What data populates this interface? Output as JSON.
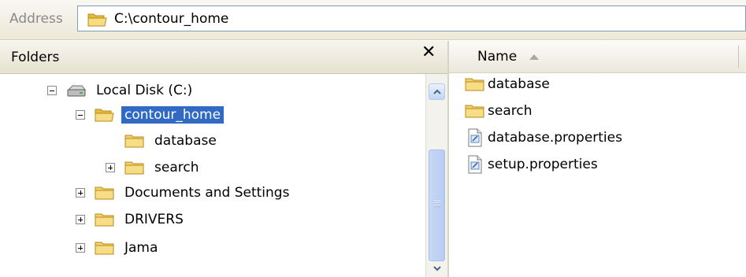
{
  "address": {
    "label": "Address",
    "path": "C:\\contour_home"
  },
  "folders_pane": {
    "title": "Folders",
    "close": "✕",
    "tree": [
      {
        "label": "Local Disk (C:)",
        "expander": "minus",
        "icon": "drive-icon"
      },
      {
        "label": "contour_home",
        "expander": "minus",
        "icon": "folder-open-icon",
        "selected": true
      },
      {
        "label": "database",
        "expander": "none",
        "icon": "folder-icon"
      },
      {
        "label": "search",
        "expander": "plus",
        "icon": "folder-icon"
      },
      {
        "label": "Documents and Settings",
        "expander": "plus",
        "icon": "folder-icon"
      },
      {
        "label": "DRIVERS",
        "expander": "plus",
        "icon": "folder-icon"
      },
      {
        "label": "Jama",
        "expander": "plus",
        "icon": "folder-icon"
      }
    ]
  },
  "file_list": {
    "column_name": "Name",
    "sort": "ascending",
    "items": [
      {
        "name": "database",
        "icon": "folder-icon"
      },
      {
        "name": "search",
        "icon": "folder-icon"
      },
      {
        "name": "database.properties",
        "icon": "properties-file-icon"
      },
      {
        "name": "setup.properties",
        "icon": "properties-file-icon"
      }
    ]
  },
  "colors": {
    "selection": "#316ac5",
    "folder": "#f4d26b",
    "scrollbar": "#c3d5f5"
  }
}
